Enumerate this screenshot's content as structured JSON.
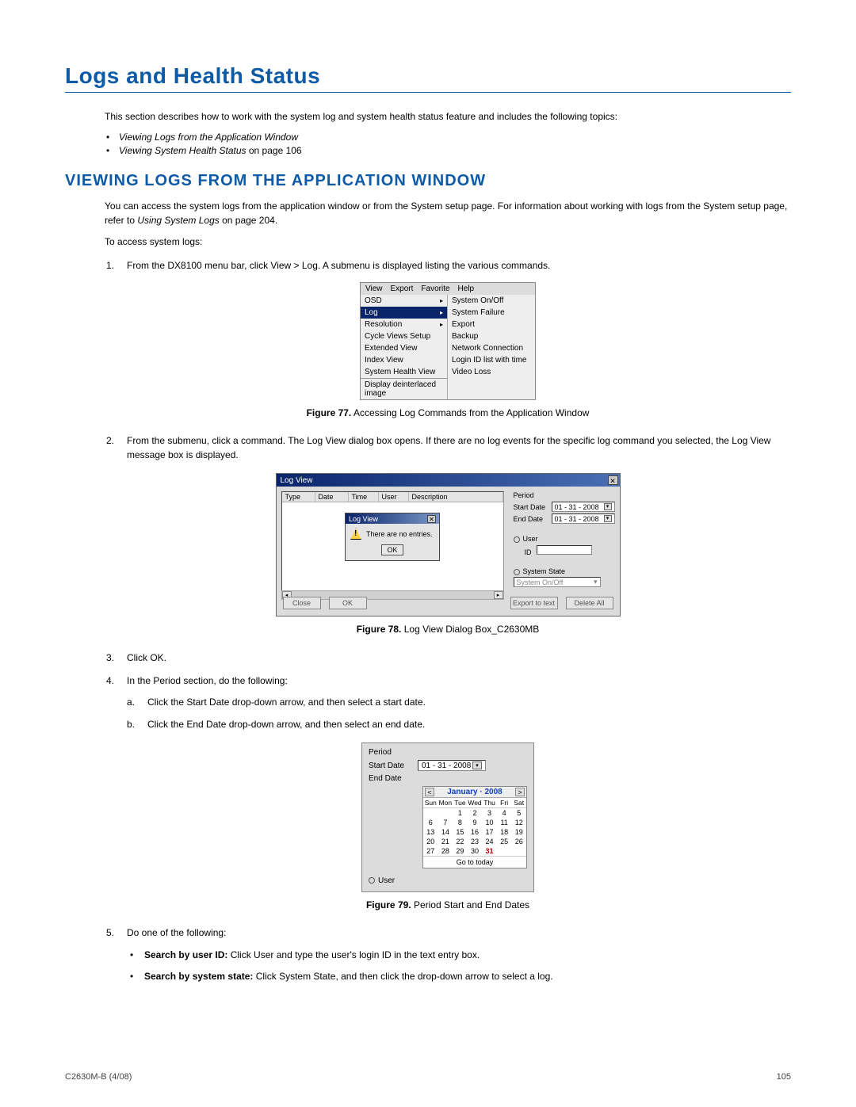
{
  "title": "Logs and Health Status",
  "intro": "This section describes how to work with the system log and system health status feature and includes the following topics:",
  "topics": {
    "a_italic": "Viewing Logs from the Application Window",
    "b_italic": "Viewing System Health Status",
    "b_rest": " on page 106"
  },
  "section": {
    "heading": "VIEWING LOGS FROM THE APPLICATION WINDOW",
    "para1a": "You can access the system logs from the application window or from the System setup page. For information about working with logs from the System setup page, refer to ",
    "para1_link": "Using System Logs",
    "para1b": " on page 204.",
    "para2": "To access system logs:",
    "step1": "From the DX8100 menu bar, click View > Log. A submenu is displayed listing the various commands.",
    "step2": "From the submenu, click a command. The Log View dialog box opens. If there are no log events for the specific log command you selected, the Log View message box is displayed.",
    "step3": "Click OK.",
    "step4": "In the Period section, do the following:",
    "step4a": "Click the Start Date drop-down arrow, and then select a start date.",
    "step4b": "Click the End Date drop-down arrow, and then select an end date.",
    "step5": "Do one of the following:",
    "step5a_bold": "Search by user ID: ",
    "step5a_rest": "Click User and type the user's login ID in the text entry box.",
    "step5b_bold": "Search by system state: ",
    "step5b_rest": "Click System State, and then click the drop-down arrow to select a log."
  },
  "captions": {
    "f77b": "Figure 77.",
    "f77": "  Accessing Log Commands from the Application Window",
    "f78b": "Figure 78.",
    "f78": "  Log View Dialog Box_C2630MB",
    "f79b": "Figure 79.",
    "f79": "  Period Start and End Dates"
  },
  "shot1": {
    "menubar": [
      "View",
      "Export",
      "Favorite",
      "Help"
    ],
    "left": [
      "OSD",
      "Log",
      "Resolution",
      "Cycle Views Setup",
      "Extended View",
      "Index View",
      "System Health View"
    ],
    "left_bottom": "Display deinterlaced image",
    "right": [
      "System On/Off",
      "System Failure",
      "Export",
      "Backup",
      "Network Connection",
      "Login ID list with time",
      "Video Loss"
    ]
  },
  "shot2": {
    "title": "Log View",
    "cols": [
      "Type",
      "Date",
      "Time",
      "User",
      "Description"
    ],
    "period": "Period",
    "start": "Start Date",
    "end": "End Date",
    "date": "01 - 31 - 2008",
    "user": "User",
    "id": "ID",
    "ss": "System State",
    "ss_val": "System On/Off",
    "close": "Close",
    "ok": "OK",
    "export": "Export to text",
    "delete": "Delete All",
    "msg_title": "Log View",
    "msg": "There are no entries.",
    "msg_ok": "OK"
  },
  "shot3": {
    "period": "Period",
    "start": "Start Date",
    "end": "End Date",
    "date": "01 - 31 - 2008",
    "month": "January · 2008",
    "days": [
      "Sun",
      "Mon",
      "Tue",
      "Wed",
      "Thu",
      "Fri",
      "Sat"
    ],
    "grid": [
      [
        "",
        "",
        "1",
        "2",
        "3",
        "4",
        "5"
      ],
      [
        "6",
        "7",
        "8",
        "9",
        "10",
        "11",
        "12"
      ],
      [
        "13",
        "14",
        "15",
        "16",
        "17",
        "18",
        "19"
      ],
      [
        "20",
        "21",
        "22",
        "23",
        "24",
        "25",
        "26"
      ],
      [
        "27",
        "28",
        "29",
        "30",
        "31",
        "",
        ""
      ]
    ],
    "today": "31",
    "go": "Go to today",
    "user": "User"
  },
  "footer": {
    "left": "C2630M-B (4/08)",
    "right": "105"
  }
}
